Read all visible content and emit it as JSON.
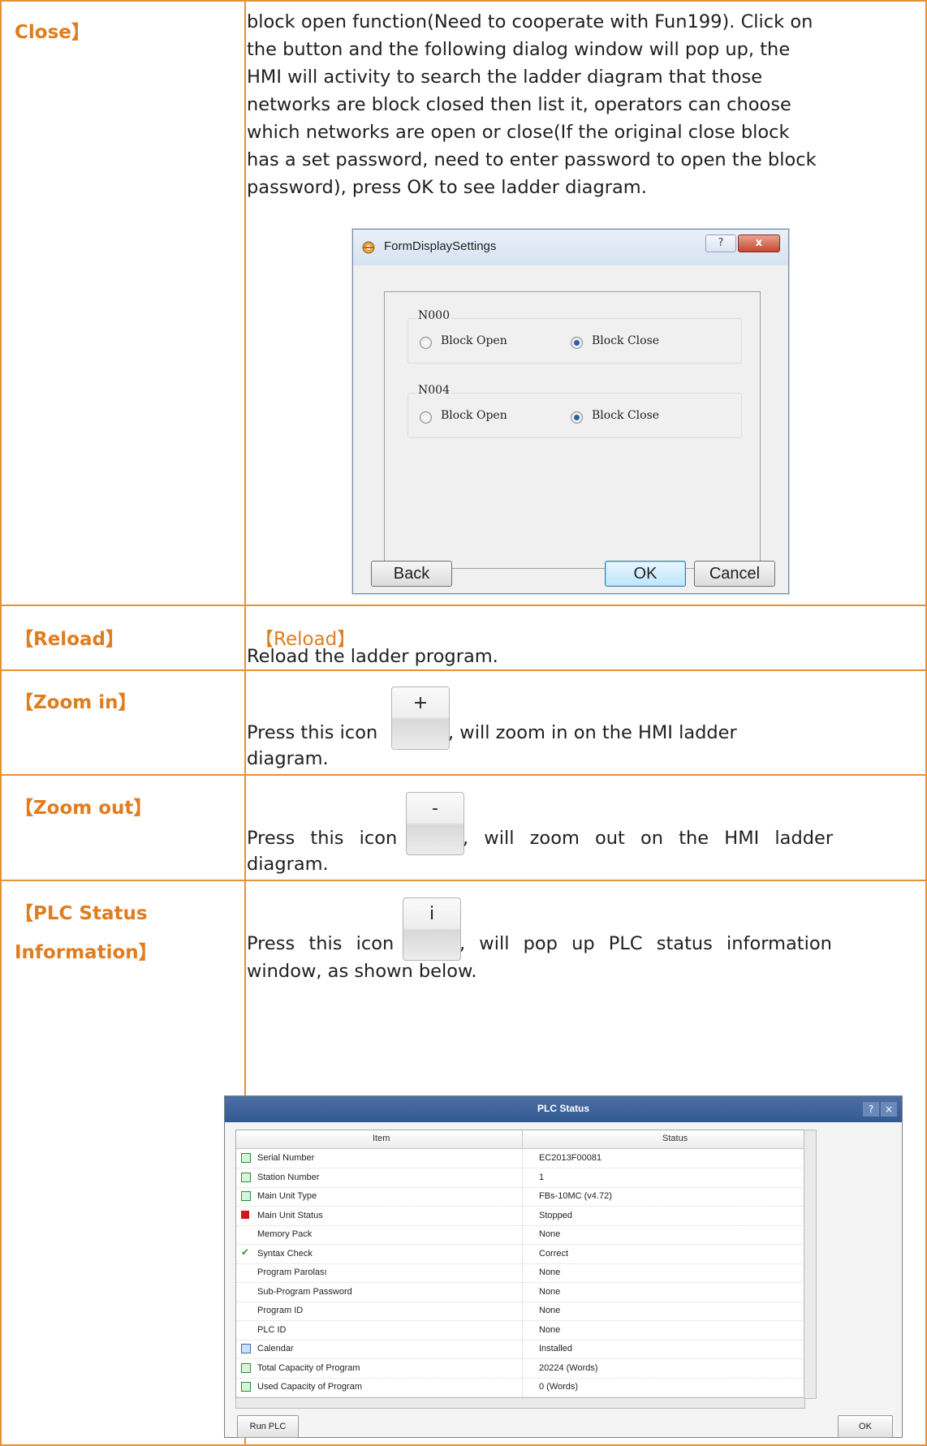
{
  "rows": {
    "close": {
      "label": "Close】",
      "lines": [
        "block open function(Need to cooperate with Fun199). Click on",
        "the button and the following dialog window will pop up, the",
        "HMI will activity to search the ladder diagram that those",
        "networks are block closed then list it, operators can choose",
        "which networks are open or close(If the original close block",
        "has a set password, need to enter password to open the block",
        "password), press OK to see ladder diagram."
      ]
    },
    "reload": {
      "label": "【Reload】",
      "heading": "【Reload】",
      "desc": "Reload the ladder program."
    },
    "zoom_in": {
      "label": "【Zoom in】",
      "before": "Press this icon",
      "after": ", will zoom in on the HMI ladder",
      "line2": "diagram.",
      "icon_glyph": "+"
    },
    "zoom_out": {
      "label": "【Zoom out】",
      "before": "Press this icon",
      "after": ", will zoom out on the HMI ladder",
      "line2": "diagram.",
      "icon_glyph": "-"
    },
    "plc_status": {
      "label_line1": "【PLC Status",
      "label_line2": "Information】",
      "before": "Press this icon",
      "after": ", will pop up PLC status information",
      "line2": "window, as shown below.",
      "icon_glyph": "i"
    }
  },
  "display_dialog": {
    "title": "FormDisplaySettings",
    "help_glyph": "?",
    "close_glyph": "x",
    "groups": [
      {
        "name": "N000",
        "option_open": "Block Open",
        "option_close": "Block Close",
        "selected": "close"
      },
      {
        "name": "N004",
        "option_open": "Block Open",
        "option_close": "Block Close",
        "selected": "close"
      }
    ],
    "back_label": "Back",
    "ok_label": "OK",
    "cancel_label": "Cancel"
  },
  "plc_window": {
    "title": "PLC Status",
    "help_glyph": "?",
    "close_glyph": "×",
    "col_item": "Item",
    "col_status": "Status",
    "rows": [
      {
        "item": "Serial Number",
        "status": "EC2013F00081",
        "icon": "green-box"
      },
      {
        "item": "Station Number",
        "status": "1",
        "icon": "green-box"
      },
      {
        "item": "Main Unit Type",
        "status": "FBs-10MC (v4.72)",
        "icon": "green-box"
      },
      {
        "item": "Main Unit Status",
        "status": "Stopped",
        "icon": "red-square"
      },
      {
        "item": "Memory Pack",
        "status": "None",
        "icon": "none"
      },
      {
        "item": "Syntax Check",
        "status": "Correct",
        "icon": "check"
      },
      {
        "item": "Program Parolası",
        "status": "None",
        "icon": "none"
      },
      {
        "item": "Sub-Program Password",
        "status": "None",
        "icon": "none"
      },
      {
        "item": "Program ID",
        "status": "None",
        "icon": "none"
      },
      {
        "item": "PLC ID",
        "status": "None",
        "icon": "none"
      },
      {
        "item": "Calendar",
        "status": "Installed",
        "icon": "calendar"
      },
      {
        "item": "Total Capacity of Program",
        "status": "20224 (Words)",
        "icon": "green-box"
      },
      {
        "item": "Used Capacity of Program",
        "status": "0 (Words)",
        "icon": "green-box"
      }
    ],
    "run_label": "Run PLC",
    "ok_label": "OK"
  }
}
